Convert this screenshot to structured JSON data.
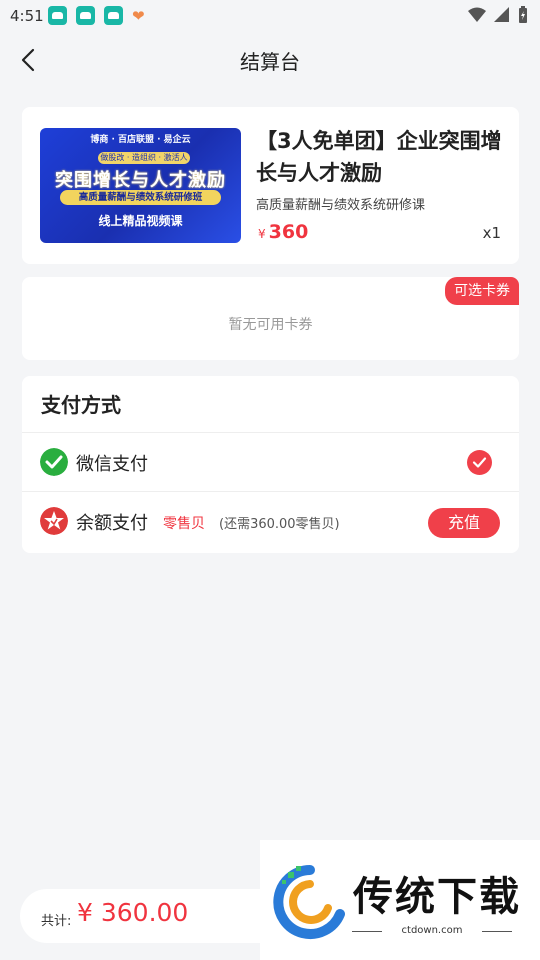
{
  "status_bar": {
    "time": "4:51"
  },
  "header": {
    "title": "结算台"
  },
  "product": {
    "thumb_top": "博商 · 百店联盟 · 易企云",
    "thumb_pill": "做股改 · 造组织 · 激活人",
    "thumb_title": "突围增长与人才激励",
    "thumb_band": "高质量薪酬与绩效系统研修班",
    "thumb_bottom": "线上精品视频课",
    "title": "【3人免单团】企业突围增长与人才激励",
    "subtitle": "高质量薪酬与绩效系统研修课",
    "currency": "¥",
    "price": "360",
    "quantity": "x1"
  },
  "coupon": {
    "badge": "可选卡券",
    "empty_text": "暂无可用卡券"
  },
  "payment": {
    "title": "支付方式",
    "wechat_label": "微信支付",
    "balance_label": "余额支付",
    "balance_brand": "零售贝",
    "balance_note": "(还需360.00零售贝)",
    "recharge_label": "充值",
    "selected": "wechat"
  },
  "footer": {
    "total_label": "共计:",
    "total_value": "¥ 360.00"
  },
  "watermark": {
    "text": "传统下载",
    "url": "ctdown.com"
  },
  "colors": {
    "accent": "#f0404a",
    "wechat": "#2aae3f",
    "background": "#f4f5f7"
  }
}
